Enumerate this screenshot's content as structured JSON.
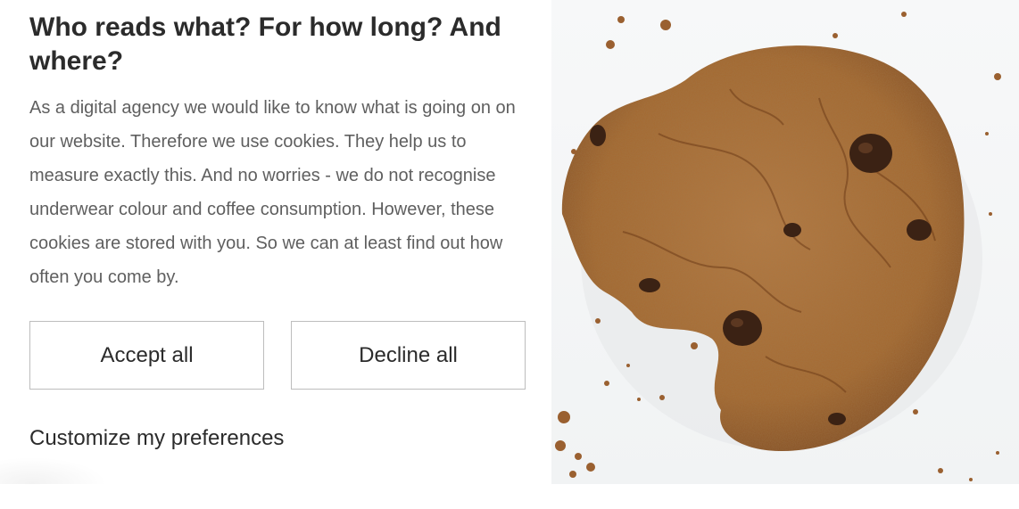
{
  "dialog": {
    "title": "Who reads what? For how long? And where?",
    "body": "As a digital agency we would like to know what is going on on our website. Therefore we use cookies. They help us to measure exactly this. And no worries - we do not recognise underwear colour and coffee consumption. However, these cookies are stored with you. So we can at least find out how often you come by.",
    "accept_label": "Accept all",
    "decline_label": "Decline all",
    "customize_label": "Customize my preferences"
  },
  "image": {
    "subject": "cookie-photo",
    "colors": {
      "cookie": "#a86a35",
      "cookie_dark": "#7a4520",
      "chocolate": "#3b2214",
      "background": "#f3f4f5"
    }
  },
  "colors": {
    "heading": "#2b2b2b",
    "body_text": "#5f5f5f",
    "button_border": "#bdbdbd"
  }
}
